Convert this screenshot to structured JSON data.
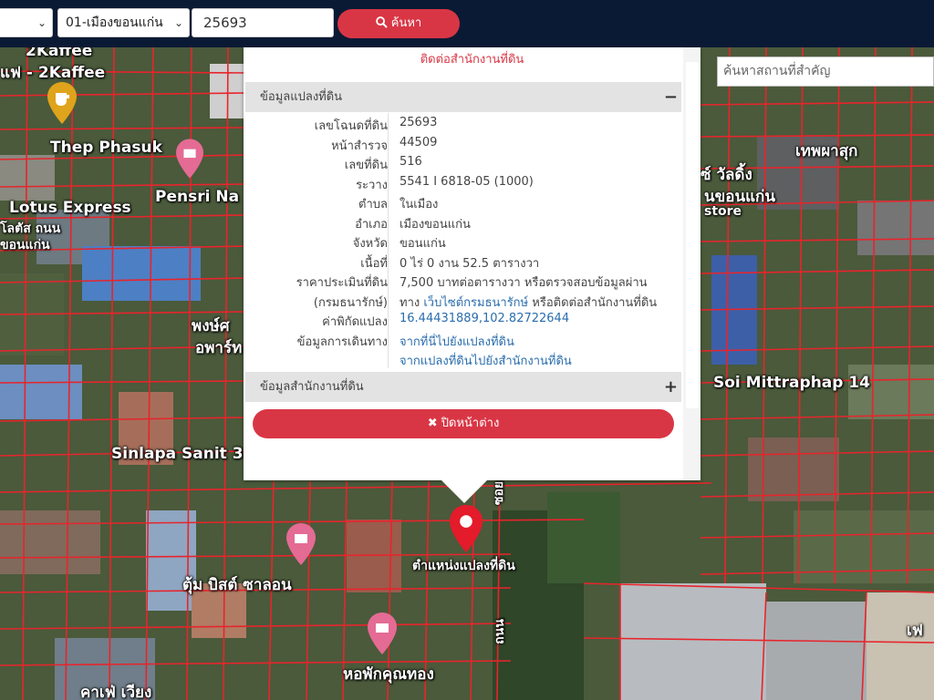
{
  "toolbar": {
    "province_value": "",
    "district_value": "01-เมืองขอนแก่น",
    "parcel_value": "25693",
    "search_label": "ค้นหา"
  },
  "place_search": {
    "placeholder": "ค้นหาสถานที่สำคัญ"
  },
  "map": {
    "labels": [
      {
        "name": "poi-2kaffee-top",
        "text": "2Kaffee"
      },
      {
        "name": "poi-2kaffee",
        "text": "แฟ - 2Kaffee"
      },
      {
        "name": "poi-thep-phasuk",
        "text": "Thep Phasuk"
      },
      {
        "name": "poi-pensri",
        "text": "Pensri Na"
      },
      {
        "name": "poi-lotus-express",
        "text": "Lotus Express"
      },
      {
        "name": "poi-lotus-th1",
        "text": "โลตัส ถนน"
      },
      {
        "name": "poi-lotus-th2",
        "text": "ขอนแก่น"
      },
      {
        "name": "poi-thep-phasuk-th",
        "text": "เทพผาสุก"
      },
      {
        "name": "poi-store-th",
        "text": "ซ์ วัลดิ้ง"
      },
      {
        "name": "poi-store-th2",
        "text": "นขอนแก่น"
      },
      {
        "name": "poi-store",
        "text": "store"
      },
      {
        "name": "poi-soi-mittraphap",
        "text": "Soi Mittraphap 14"
      },
      {
        "name": "poi-silapa",
        "text": "Sinlapa Sanit 3"
      },
      {
        "name": "poi-dum",
        "text": "ตุ้ม บิสต์ ซาลอน"
      },
      {
        "name": "poi-hor",
        "text": "หอพักคุณทอง"
      },
      {
        "name": "poi-bottom",
        "text": "คาเฟ่ เวียง"
      },
      {
        "name": "poi-parcel-location",
        "text": "ตำแหน่งแปลงที่ดิน"
      },
      {
        "name": "poi-pongsri",
        "text": "พงษ์ศ"
      },
      {
        "name": "poi-apartment",
        "text": "อพาร์ท"
      },
      {
        "name": "poi-right-edge",
        "text": "เฟ"
      },
      {
        "name": "poi-road-vert",
        "text": "ถนน"
      },
      {
        "name": "poi-road-vert2",
        "text": "ซอย"
      }
    ]
  },
  "popup": {
    "notice": "ติดต่อสำนักงานที่ดิน",
    "section_info_title": "ข้อมูลแปลงที่ดิน",
    "section_info_toggle": "−",
    "rows": [
      {
        "key": "เลขโฉนดที่ดิน",
        "value": "25693"
      },
      {
        "key": "หน้าสำรวจ",
        "value": "44509"
      },
      {
        "key": "เลขที่ดิน",
        "value": "516"
      },
      {
        "key": "ระวาง",
        "value": "5541 I 6818-05 (1000)"
      },
      {
        "key": "ตำบล",
        "value": "ในเมือง"
      },
      {
        "key": "อำเภอ",
        "value": "เมืองขอนแก่น"
      },
      {
        "key": "จังหวัด",
        "value": "ขอนแก่น"
      },
      {
        "key": "เนื้อที่",
        "value": "0 ไร่ 0 งาน 52.5 ตารางวา"
      },
      {
        "key": "ราคาประเมินที่ดิน",
        "value": "7,500 บาทต่อตารางวา หรือตรวจสอบข้อมูลผ่าน"
      }
    ],
    "price_dept_key": "(กรมธนารักษ์)",
    "price_line2_a": "ทาง",
    "price_line2_link": "เว็บไซต์กรมธนารักษ์",
    "price_line2_b": "หรือติดต่อสำนักงานที่ดิน",
    "coord_key": "ค่าพิกัดแปลง",
    "coord_value": "16.44431889,102.82722644",
    "directions_key": "ข้อมูลการเดินทาง",
    "directions_link1": "จากที่นี่ไปยังแปลงที่ดิน",
    "directions_link2": "จากแปลงที่ดินไปยังสำนักงานที่ดิน",
    "section_office_title": "ข้อมูลสำนักงานที่ดิน",
    "section_office_toggle": "+",
    "close_label": "ปิดหน้าต่าง"
  },
  "colors": {
    "accent": "#d93645",
    "topbar": "#0b1a34",
    "link": "#2a6dad",
    "parcel_line": "#e8242c"
  },
  "icons": [
    "search-icon",
    "close-x-icon",
    "map-pin-icon",
    "coffee-pin-icon",
    "shopping-pin-icon",
    "chevron-down-icon"
  ]
}
